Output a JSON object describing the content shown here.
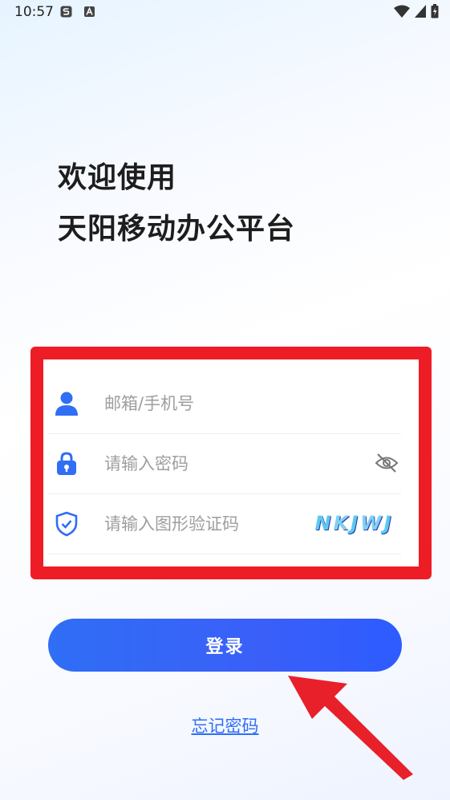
{
  "status_bar": {
    "time": "10:57",
    "left_icons": [
      "sim-s-icon",
      "notification-a-icon"
    ],
    "right_icons": [
      "wifi-icon",
      "signal-icon",
      "battery-icon"
    ]
  },
  "welcome": {
    "line1": "欢迎使用",
    "line2": "天阳移动办公平台"
  },
  "form": {
    "account": {
      "placeholder": "邮箱/手机号",
      "value": "",
      "icon": "user-icon"
    },
    "password": {
      "placeholder": "请输入密码",
      "value": "",
      "icon": "lock-icon",
      "toggle_icon": "eye-off-icon"
    },
    "captcha": {
      "placeholder": "请输入图形验证码",
      "value": "",
      "icon": "shield-check-icon",
      "image_text": "NKJWJ"
    }
  },
  "login_button": {
    "label": "登录"
  },
  "forgot_link": {
    "label": "忘记密码"
  },
  "colors": {
    "accent": "#2f6ef5",
    "highlight_frame": "#ee1c25",
    "annotation_arrow": "#e8202a"
  }
}
